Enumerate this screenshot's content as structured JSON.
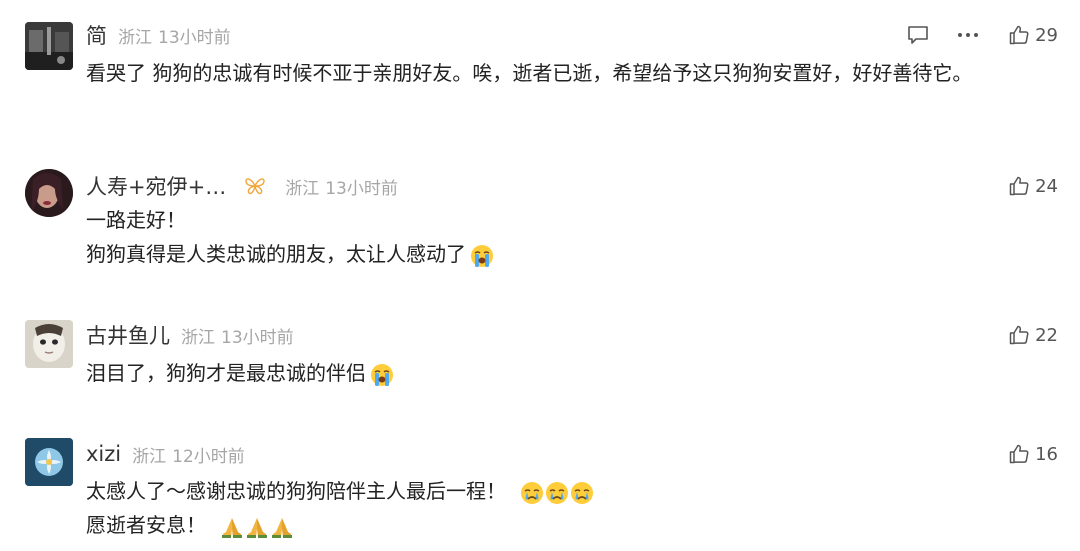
{
  "comments": [
    {
      "username": "简",
      "location": "浙江",
      "time": "13小时前",
      "likes": "29",
      "lines": [
        "看哭了 狗狗的忠诚有时候不亚于亲朋好友。唉，逝者已逝，希望给予这只狗狗安置好，好好善待它。"
      ]
    },
    {
      "username": "人寿+宛伊+…",
      "location": "浙江",
      "time": "13小时前",
      "likes": "24",
      "lines": [
        "一路走好！",
        "狗狗真得是人类忠诚的朋友，太让人感动了"
      ]
    },
    {
      "username": "古井鱼儿",
      "location": "浙江",
      "time": "13小时前",
      "likes": "22",
      "lines": [
        "泪目了，狗狗才是最忠诚的伴侣"
      ]
    },
    {
      "username": "xizi",
      "location": "浙江",
      "time": "12小时前",
      "likes": "16",
      "lines": [
        "太感人了～感谢忠诚的狗狗陪伴主人最后一程！",
        "愿逝者安息！"
      ]
    }
  ],
  "icons": {
    "reply": "speech-bubble-icon",
    "more": "ellipsis-icon",
    "like": "thumbs-up-icon",
    "badge": "butterfly-badge-icon",
    "loudly_crying": "loudly-crying-emoji",
    "crying": "crying-emoji",
    "pray": "folded-hands-emoji"
  },
  "colors": {
    "meta": "#a6a6a6",
    "text": "#222222",
    "badge": "#f0a63a"
  }
}
